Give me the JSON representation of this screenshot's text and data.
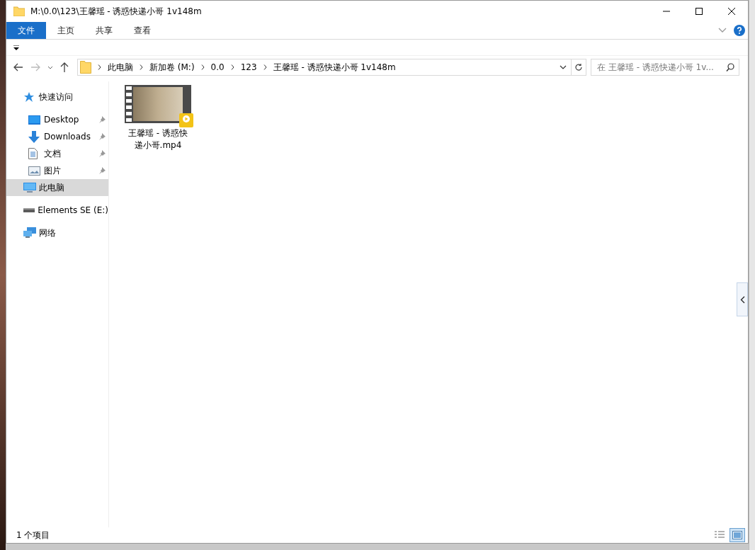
{
  "window": {
    "title": "M:\\0.0\\123\\王馨瑶 - 诱惑快递小哥 1v148m"
  },
  "ribbon_tabs": [
    {
      "label": "文件",
      "selected": true
    },
    {
      "label": "主页",
      "selected": false
    },
    {
      "label": "共享",
      "selected": false
    },
    {
      "label": "查看",
      "selected": false
    }
  ],
  "breadcrumb": [
    "此电脑",
    "新加卷 (M:)",
    "0.0",
    "123",
    "王馨瑶 - 诱惑快递小哥 1v148m"
  ],
  "search": {
    "placeholder": "在 王馨瑶 - 诱惑快递小哥 1v..."
  },
  "sidebar": {
    "items": [
      {
        "label": "快速访问",
        "kind": "quick",
        "selected": false,
        "pinned": false,
        "children": [
          {
            "label": "Desktop",
            "kind": "desktop",
            "selected": false,
            "pinned": true
          },
          {
            "label": "Downloads",
            "kind": "downloads",
            "selected": false,
            "pinned": true
          },
          {
            "label": "文档",
            "kind": "documents",
            "selected": false,
            "pinned": true
          },
          {
            "label": "图片",
            "kind": "pictures",
            "selected": false,
            "pinned": true
          }
        ]
      },
      {
        "label": "此电脑",
        "kind": "pc",
        "selected": true,
        "pinned": false
      },
      {
        "label": "Elements SE (E:)",
        "kind": "drive",
        "selected": false,
        "pinned": false
      },
      {
        "label": "网络",
        "kind": "network",
        "selected": false,
        "pinned": false
      }
    ]
  },
  "files": [
    {
      "name": "王馨瑶 - 诱惑快递小哥.mp4",
      "selected": false
    }
  ],
  "status_bar": {
    "count": "1 个项目"
  }
}
